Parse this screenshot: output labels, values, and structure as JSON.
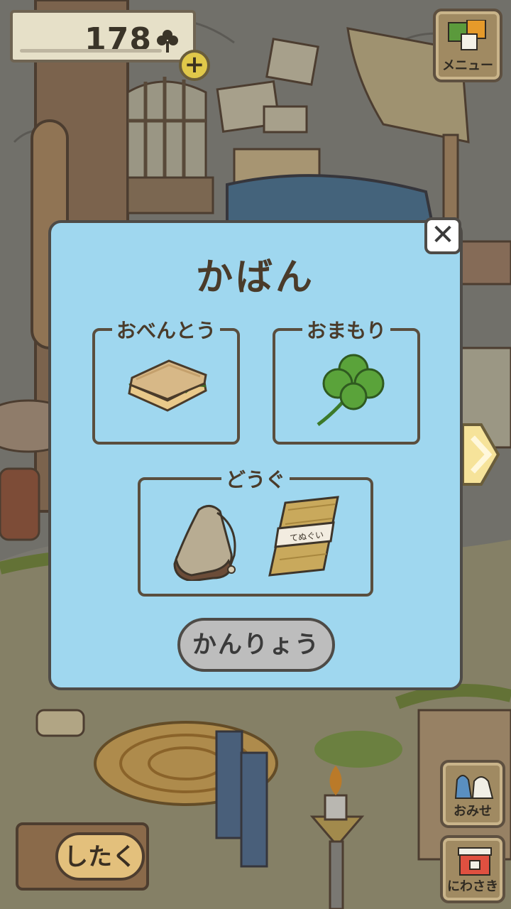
{
  "currency": {
    "amount": "178",
    "icon": "clover-icon",
    "add_icon": "plus-icon"
  },
  "menu": {
    "label": "メニュー"
  },
  "modal": {
    "title": "かばん",
    "slots": [
      {
        "label": "おべんとう",
        "item": "sandwich"
      },
      {
        "label": "おまもり",
        "item": "four-leaf-clover"
      },
      {
        "label": "どうぐ",
        "items": [
          "canteen",
          "tenugui-roll"
        ]
      }
    ],
    "tenugui_text": "てぬぐい",
    "done_label": "かんりょう",
    "close_glyph": "✕"
  },
  "side_buttons": {
    "shop_label": "おみせ",
    "garden_label": "にわさき"
  },
  "prepare": {
    "label": "したく"
  },
  "colors": {
    "modal_bg": "#9fd7ef",
    "border": "#4e4b47",
    "done_bg": "#bdbdbd"
  }
}
